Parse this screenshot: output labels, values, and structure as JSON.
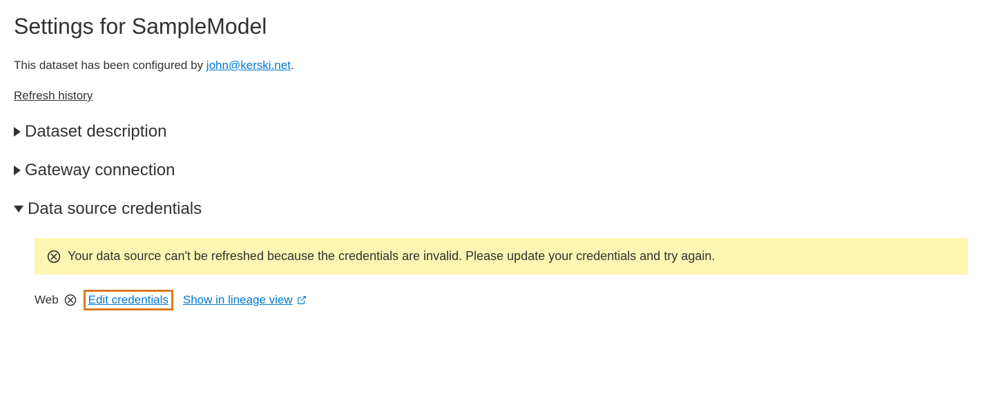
{
  "page": {
    "title": "Settings for SampleModel",
    "configured_prefix": "This dataset has been configured by ",
    "configured_email": "john@kerski.net",
    "configured_suffix": ".",
    "refresh_history": "Refresh history"
  },
  "sections": {
    "dataset_description": {
      "label": "Dataset description",
      "expanded": false
    },
    "gateway_connection": {
      "label": "Gateway connection",
      "expanded": false
    },
    "data_source_credentials": {
      "label": "Data source credentials",
      "expanded": true,
      "warning": "Your data source can't be refreshed because the credentials are invalid. Please update your credentials and try again.",
      "datasource": {
        "type_label": "Web",
        "edit_link": "Edit credentials",
        "lineage_link": "Show in lineage view"
      }
    }
  }
}
